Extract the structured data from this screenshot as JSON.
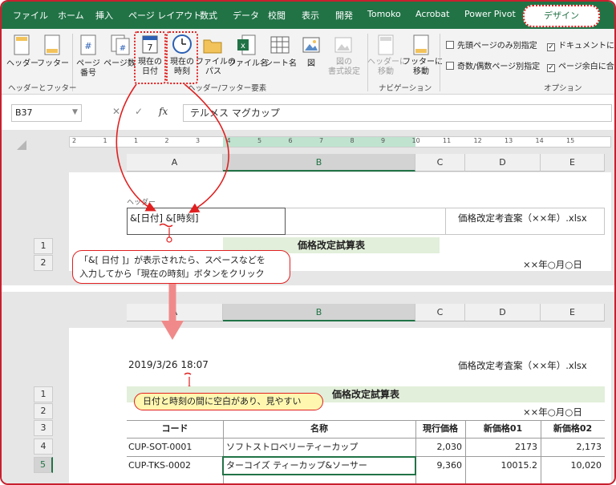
{
  "tabs": [
    "ファイル",
    "ホーム",
    "挿入",
    "ページ レイアウト",
    "数式",
    "データ",
    "校閲",
    "表示",
    "開発",
    "Tomoko",
    "Acrobat",
    "Power Pivot"
  ],
  "active_tab": "デザイン",
  "ribbon": {
    "header_label": "ヘッダー",
    "footer_label": "フッター",
    "page_number_label": [
      "ページ",
      "番号"
    ],
    "page_count_label": "ページ数",
    "current_date_label": [
      "現在の",
      "日付"
    ],
    "current_time_label": [
      "現在の",
      "時刻"
    ],
    "file_path_label": [
      "ファイルの",
      "パス"
    ],
    "file_name_label": "ファイル名",
    "sheet_name_label": "シート名",
    "picture_label": "図",
    "format_picture_label": [
      "図の",
      "書式設定"
    ],
    "goto_header_label": [
      "ヘッダーに",
      "移動"
    ],
    "goto_footer_label": [
      "フッターに",
      "移動"
    ],
    "group_header_footer": "ヘッダーとフッター",
    "group_elements": "ヘッダー/フッター要素",
    "group_navigation": "ナビゲーション",
    "group_options": "オプション",
    "options": [
      {
        "label": "先頭ページのみ別指定",
        "checked": false
      },
      {
        "label": "ドキュメントに合",
        "checked": true
      },
      {
        "label": "奇数/偶数ページ別指定",
        "checked": false
      },
      {
        "label": "ページ余白に合",
        "checked": true
      }
    ]
  },
  "formula_bar": {
    "name_box": "B37",
    "fx": "fx",
    "formula": "テルメス マグカップ"
  },
  "ruler_labels": [
    "2",
    "1",
    "1",
    "2",
    "3",
    "4",
    "5",
    "6",
    "7",
    "8",
    "9",
    "10",
    "11",
    "12",
    "13",
    "14",
    "15"
  ],
  "top_view": {
    "columns": [
      "A",
      "B",
      "C",
      "D",
      "E"
    ],
    "header_caption": "ヘッダー",
    "header_left": "&[日付] &[時刻]",
    "header_right": "価格改定考査案（××年）.xlsx",
    "rows": [
      "1",
      "2"
    ],
    "title": "価格改定試算表",
    "date_text": "××年○月○日"
  },
  "callout_top": {
    "line1": "「&[ 日付 ]」が表示されたら、スペースなどを",
    "line2": "入力してから「現在の時刻」ボタンをクリック"
  },
  "bottom_view": {
    "columns": [
      "A",
      "B",
      "C",
      "D",
      "E"
    ],
    "header_left": "2019/3/26  18:07",
    "header_right": "価格改定考査案（××年）.xlsx",
    "rows": [
      "1",
      "2",
      "3",
      "4",
      "5"
    ],
    "title": "価格改定試算表",
    "date_text": "××年○月○日",
    "table_headers": [
      "コード",
      "名称",
      "現行価格",
      "新価格01",
      "新価格02"
    ],
    "table_rows": [
      {
        "code": "CUP-SOT-0001",
        "name": "ソフトストロベリーティーカップ",
        "current": "2,030",
        "new1": "2173",
        "new2": "2,173"
      },
      {
        "code": "CUP-TKS-0002",
        "name": "ターコイズ ティーカップ&ソーサー",
        "current": "9,360",
        "new1": "10015.2",
        "new2": "10,020"
      }
    ]
  },
  "callout_bottom": "日付と時刻の間に空白があり、見やすい",
  "colors": {
    "excel_green": "#217346",
    "callout_red": "#e02020",
    "title_fill": "#e2efda",
    "callout_yellow": "#fff7b0"
  }
}
